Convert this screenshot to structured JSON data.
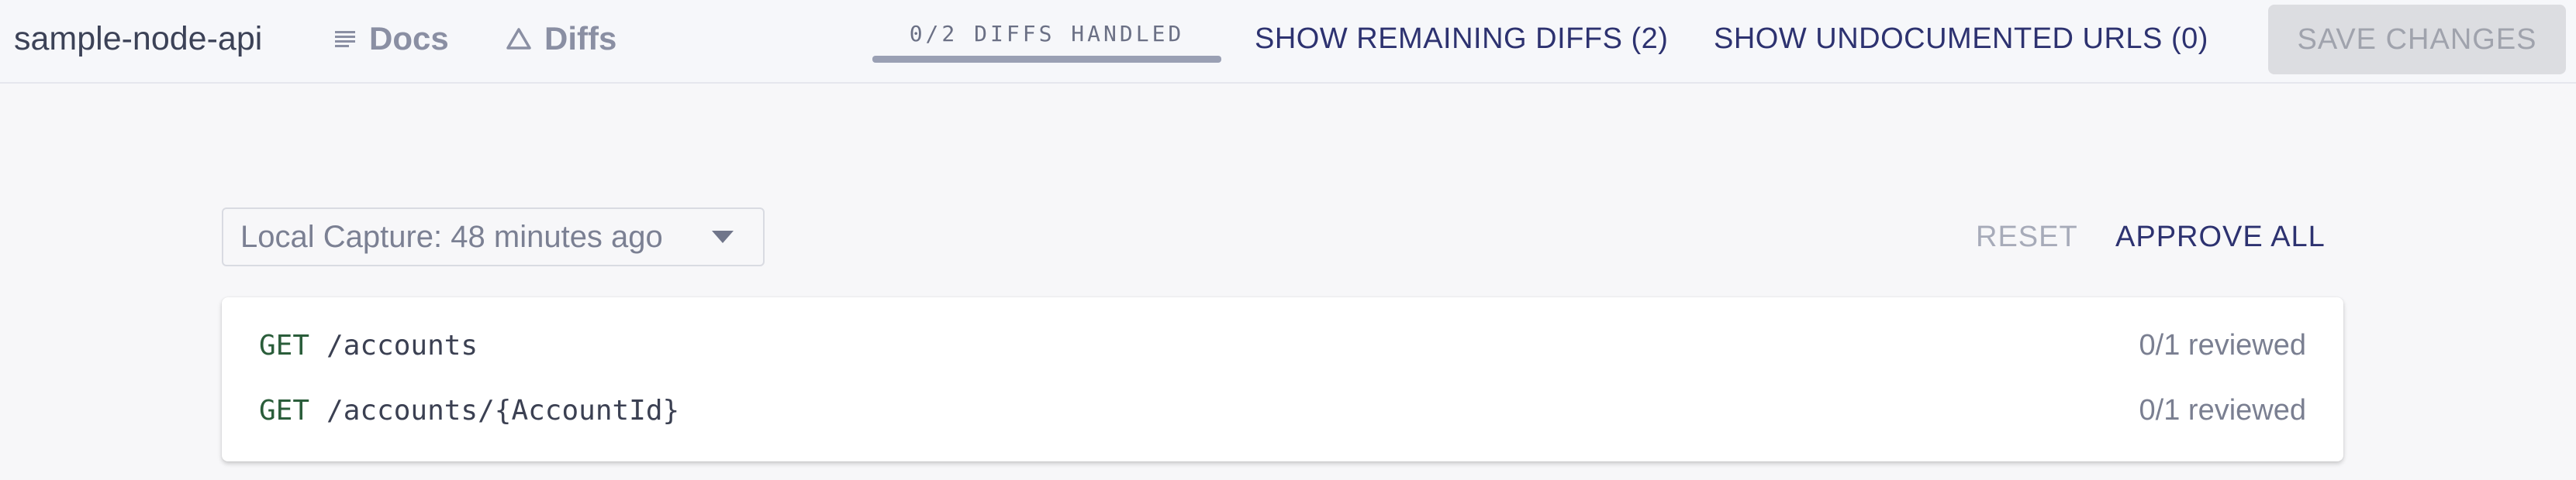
{
  "header": {
    "app_name": "sample-node-api",
    "nav": [
      {
        "label": "Docs",
        "icon": "docs-lines-icon"
      },
      {
        "label": "Diffs",
        "icon": "triangle-icon"
      }
    ],
    "progress": {
      "label": "0/2 DIFFS HANDLED",
      "handled": 0,
      "total": 2
    },
    "show_remaining_label": "SHOW REMAINING DIFFS (2)",
    "show_undocumented_label": "SHOW UNDOCUMENTED URLS (0)",
    "save_label": "SAVE CHANGES"
  },
  "controls": {
    "capture_selected": "Local Capture: 48 minutes ago",
    "reset_label": "RESET",
    "approve_all_label": "APPROVE ALL"
  },
  "endpoints": [
    {
      "method": "GET",
      "path": "/accounts",
      "status": "0/1 reviewed"
    },
    {
      "method": "GET",
      "path": "/accounts/{AccountId}",
      "status": "0/1 reviewed"
    }
  ],
  "colors": {
    "accent": "#2d3270",
    "method": "#2a5d3a",
    "disabled_button_bg": "#dcdde1"
  }
}
